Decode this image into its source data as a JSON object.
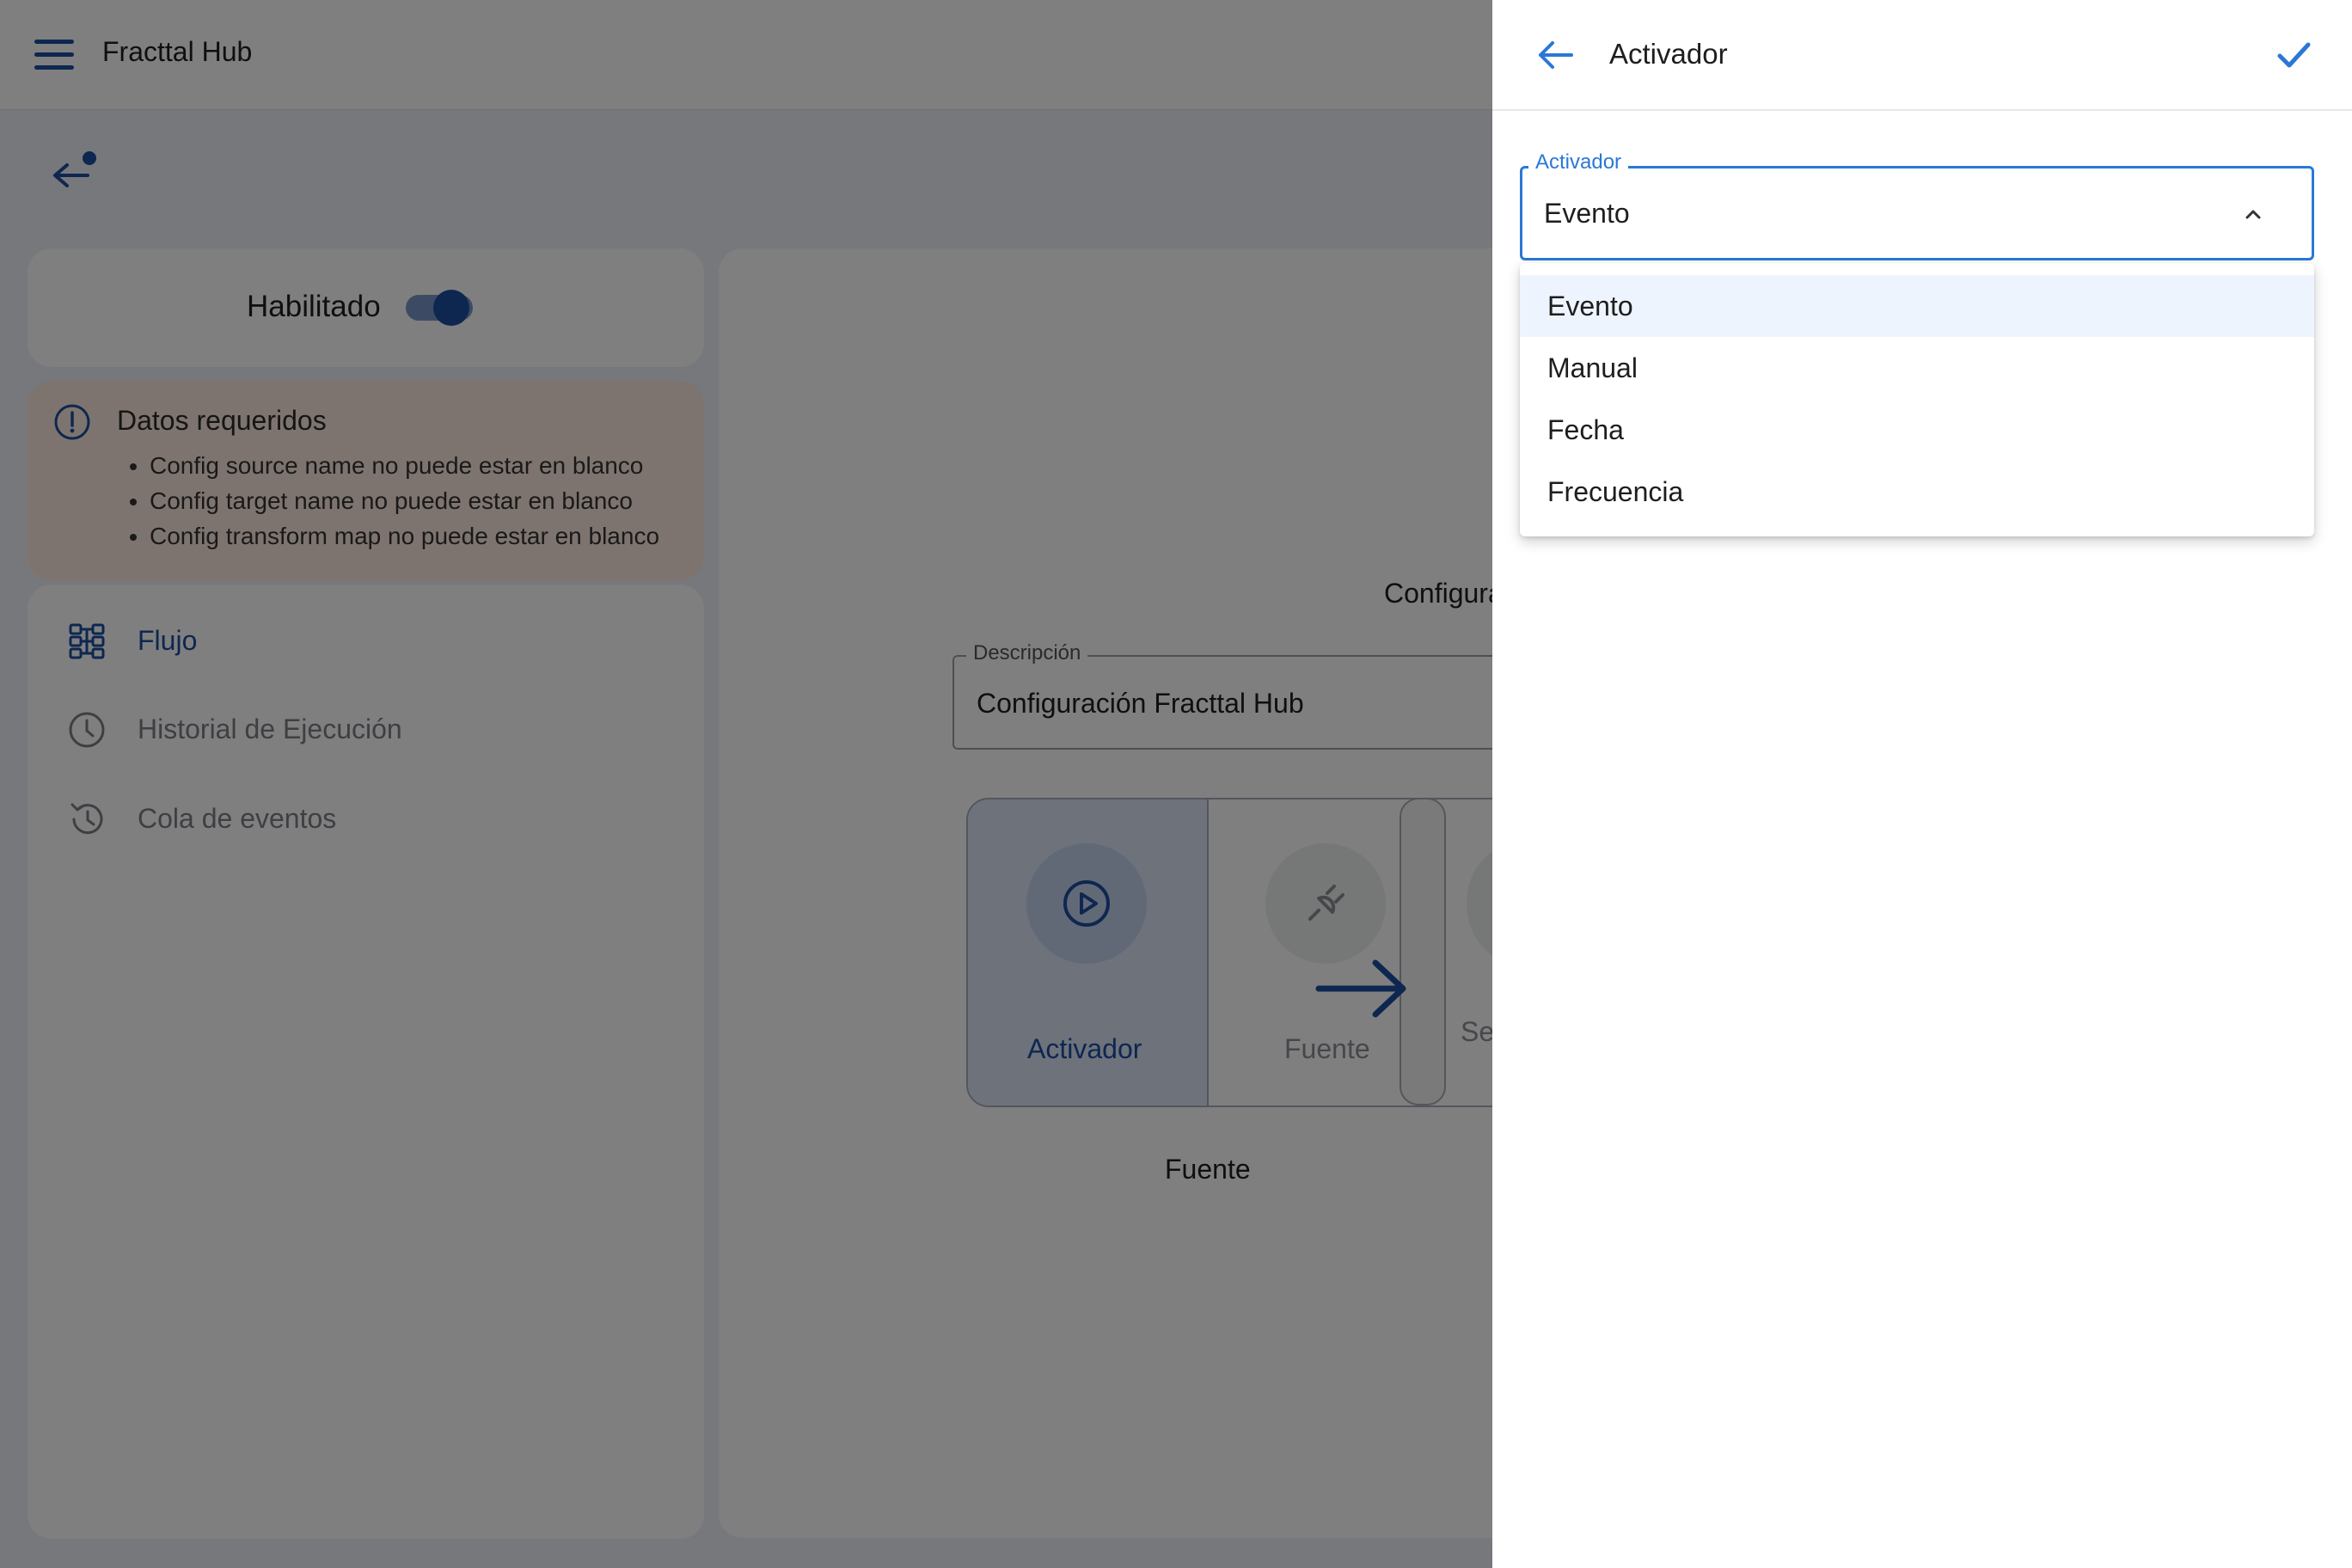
{
  "app": {
    "title": "Fracttal Hub"
  },
  "status": {
    "enabled_label": "Habilitado",
    "enabled": true
  },
  "alert": {
    "title": "Datos requeridos",
    "items": [
      "Config source name no puede estar en blanco",
      "Config target name no puede estar en blanco",
      "Config transform map no puede estar en blanco"
    ]
  },
  "sidebar": {
    "items": [
      {
        "label": "Flujo",
        "icon": "flow-icon",
        "active": true
      },
      {
        "label": "Historial de Ejecución",
        "icon": "clock-icon",
        "active": false
      },
      {
        "label": "Cola de eventos",
        "icon": "history-icon",
        "active": false
      }
    ]
  },
  "main": {
    "config_title": "Configura",
    "description": {
      "label": "Descripción",
      "value": "Configuración Fracttal Hub"
    },
    "steps": [
      {
        "label": "Activador",
        "icon": "play-circle-icon"
      },
      {
        "label": "Fuente",
        "icon": "plug-icon"
      },
      {
        "label": "Se",
        "icon": ""
      }
    ],
    "below_label": "Fuente"
  },
  "panel": {
    "title": "Activador",
    "select": {
      "label": "Activador",
      "value": "Evento",
      "options": [
        "Evento",
        "Manual",
        "Fecha",
        "Frecuencia"
      ]
    }
  },
  "colors": {
    "primary": "#1d4ea0",
    "accent": "#2a78d6",
    "alert_bg": "#fde9df"
  }
}
